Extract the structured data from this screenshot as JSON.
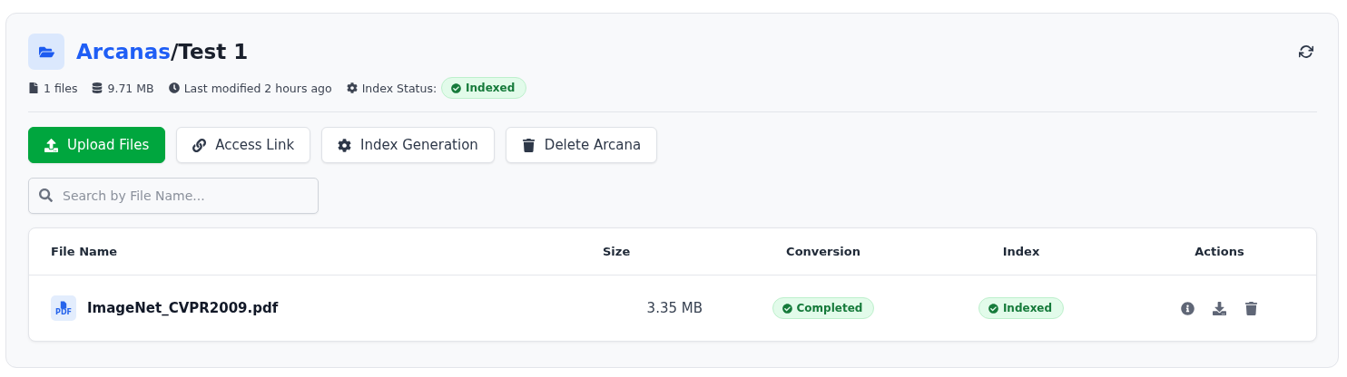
{
  "header": {
    "breadcrumb_link": "Arcanas",
    "separator": "/",
    "title": "Test 1"
  },
  "meta": [
    {
      "kind": "file",
      "text": "1 files"
    },
    {
      "kind": "storage",
      "text": "9.71 MB"
    },
    {
      "kind": "clock",
      "text": "Last modified 2 hours ago"
    },
    {
      "kind": "gear",
      "text": "Index Status:"
    }
  ],
  "index_status": {
    "label": "Indexed",
    "kind": "success"
  },
  "buttons": [
    {
      "label": "Upload Files",
      "kind": "upload",
      "primary": true
    },
    {
      "label": "Access Link",
      "kind": "link",
      "primary": false
    },
    {
      "label": "Index Generation",
      "kind": "gear",
      "primary": false
    },
    {
      "label": "Delete Arcana",
      "kind": "trash",
      "primary": false
    }
  ],
  "search": {
    "placeholder": "Search by File Name..."
  },
  "table": {
    "columns": [
      "File Name",
      "Size",
      "Conversion",
      "Index",
      "Actions"
    ],
    "rows": [
      {
        "file_icon_label": "PDF",
        "name": "ImageNet_CVPR2009.pdf",
        "size": "3.35 MB",
        "conversion": {
          "label": "Completed",
          "kind": "success"
        },
        "index": {
          "label": "Indexed",
          "kind": "success"
        },
        "actions": [
          {
            "kind": "info"
          },
          {
            "kind": "download"
          },
          {
            "kind": "trash"
          }
        ]
      }
    ]
  }
}
